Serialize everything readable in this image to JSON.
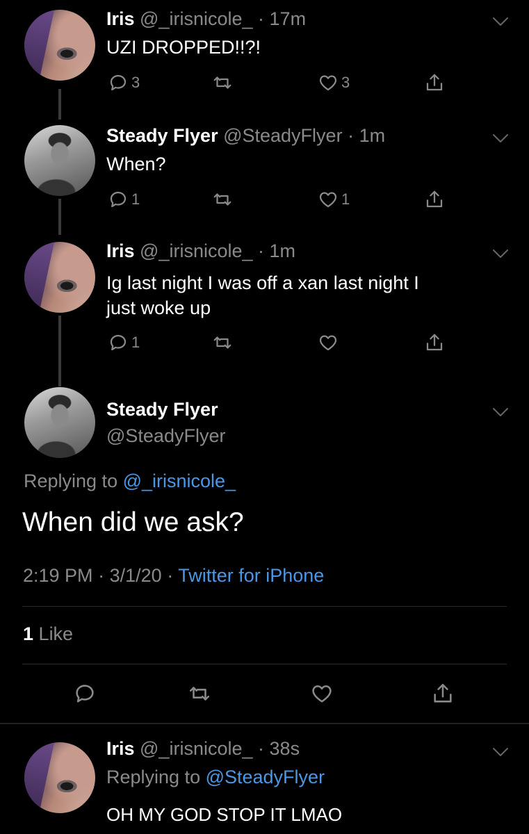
{
  "thread": [
    {
      "name": "Iris",
      "handle": "@_irisnicole_",
      "time": "· 17m",
      "text": "UZI DROPPED!!?!",
      "replies": "3",
      "retweets": "",
      "likes": "3"
    },
    {
      "name": "Steady Flyer",
      "handle": "@SteadyFlyer",
      "time": "· 1m",
      "text": "When?",
      "replies": "1",
      "retweets": "",
      "likes": "1"
    },
    {
      "name": "Iris",
      "handle": "@_irisnicole_",
      "time": "· 1m",
      "text_line1": "Ig last night I was off a xan last night I",
      "text_line2": "just woke up",
      "replies": "1",
      "retweets": "",
      "likes": ""
    }
  ],
  "focused": {
    "name": "Steady Flyer",
    "handle": "@SteadyFlyer",
    "replying_prefix": "Replying to ",
    "replying_to": "@_irisnicole_",
    "text": "When did we ask?",
    "time": "2:19 PM",
    "date": "3/1/20",
    "sep": "·",
    "source": "Twitter for iPhone",
    "like_count": "1",
    "like_label": "Like"
  },
  "reply": {
    "name": "Iris",
    "handle": "@_irisnicole_",
    "time": "· 38s",
    "replying_prefix": "Replying to ",
    "replying_to": "@SteadyFlyer",
    "text": "OH MY GOD STOP IT LMAO"
  },
  "colors": {
    "background": "#000000",
    "link": "#4a97e6",
    "secondary_text": "#8a8a8a"
  },
  "icons": [
    "reply-icon",
    "retweet-icon",
    "like-icon",
    "share-icon",
    "chevron-down-icon"
  ]
}
